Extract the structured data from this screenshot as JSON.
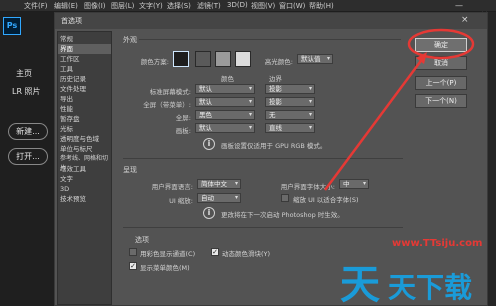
{
  "app": {
    "logo": "Ps",
    "menu": [
      "文件(F)",
      "编辑(E)",
      "图像(I)",
      "图层(L)",
      "文字(Y)",
      "选择(S)",
      "滤镜(T)",
      "3D(D)",
      "视图(V)",
      "窗口(W)",
      "帮助(H)"
    ],
    "window_controls": "—  ▢  ✕"
  },
  "start_sidebar": {
    "home": "主页",
    "lr_photos": "LR 照片",
    "new_button": "新建...",
    "open_button": "打开..."
  },
  "dialog": {
    "title": "首选项",
    "close": "×",
    "categories": [
      "常规",
      "界面",
      "工作区",
      "工具",
      "历史记录",
      "文件处理",
      "导出",
      "性能",
      "暂存盘",
      "光标",
      "透明度与色域",
      "单位与标尺",
      "参考线、网格和切片",
      "增效工具",
      "文字",
      "3D",
      "技术预览"
    ],
    "selected_category": 1,
    "appearance": {
      "title": "外观",
      "color_theme_label": "颜色方案:",
      "theme_swatches": [
        "#1e1e1e",
        "#5a5a5a",
        "#9a9a9a",
        "#dcdcdc"
      ],
      "highlight_label": "高光颜色:",
      "highlight_value": "默认值",
      "col_color": "颜色",
      "col_border": "边界",
      "rows": [
        {
          "label": "标准屏幕模式:",
          "color": "默认",
          "border": "投影"
        },
        {
          "label": "全屏（带菜单）:",
          "color": "默认",
          "border": "投影"
        },
        {
          "label": "全屏:",
          "color": "黑色",
          "border": "无"
        },
        {
          "label": "画板:",
          "color": "默认",
          "border": "直线"
        }
      ],
      "info": "画板设置仅适用于 GPU RGB 模式。"
    },
    "presentation": {
      "title": "呈现",
      "ui_language_label": "用户界面语言:",
      "ui_language_value": "简体中文",
      "ui_font_size_label": "用户界面字体大小:",
      "ui_font_size_value": "中",
      "ui_scale_label": "UI 缩放:",
      "ui_scale_value": "自动",
      "scale_font_label": "缩放 UI 以适合字体(S)",
      "info": "更改将在下一次启动 Photoshop 时生效。"
    },
    "options": {
      "title": "选项",
      "show_channels_color": "用彩色显示通道(C)",
      "dynamic_sliders": "动态颜色滑块(Y)",
      "show_menu_colors": "显示菜单颜色(M)"
    },
    "buttons": {
      "ok": "确定",
      "cancel": "取消",
      "prev": "上一个(P)",
      "next": "下一个(N)"
    }
  },
  "watermark": {
    "url": "www.TTsiju.com",
    "main": "天",
    "sub": "天下载"
  },
  "annotation_color": "#e53935"
}
